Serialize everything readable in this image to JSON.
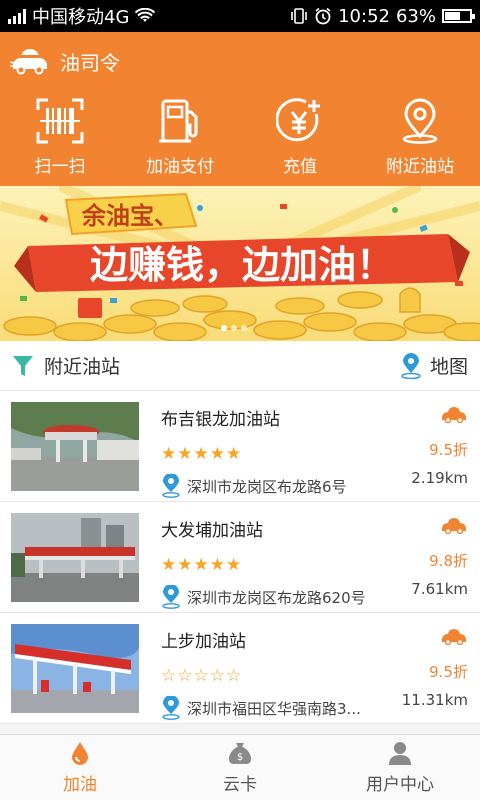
{
  "status_bar": {
    "carrier": "中国移动4G",
    "time": "10:52",
    "battery": "63%",
    "battery_level": 0.63,
    "icons": [
      "signal-icon",
      "wifi-icon",
      "vibrate-icon",
      "alarm-icon",
      "battery-icon"
    ]
  },
  "header": {
    "app_title": "油司令",
    "actions": [
      {
        "label": "扫一扫",
        "icon": "scan-icon"
      },
      {
        "label": "加油支付",
        "icon": "fuel-pump-icon"
      },
      {
        "label": "充值",
        "icon": "recharge-icon"
      },
      {
        "label": "附近油站",
        "icon": "location-pin-icon"
      }
    ]
  },
  "banner": {
    "tag": "余油宝、",
    "slogan": "边赚钱，边加油！",
    "page_count": 3,
    "active_page": 1
  },
  "section": {
    "title": "附近油站",
    "map_label": "地图",
    "icons": [
      "filter-icon",
      "map-pin-icon"
    ]
  },
  "stations": [
    {
      "name": "布吉银龙加油站",
      "rating": 5,
      "discount": "9.5折",
      "address": "深圳市龙岗区布龙路6号",
      "distance": "2.19km"
    },
    {
      "name": "大发埔加油站",
      "rating": 5,
      "discount": "9.8折",
      "address": "深圳市龙岗区布龙路620号",
      "distance": "7.61km"
    },
    {
      "name": "上步加油站",
      "rating": 0,
      "discount": "9.5折",
      "address": "深圳市福田区华强南路3...",
      "distance": "11.31km"
    }
  ],
  "tabbar": {
    "tabs": [
      {
        "label": "加油",
        "icon": "oil-drop-icon",
        "active": true
      },
      {
        "label": "云卡",
        "icon": "money-bag-icon",
        "active": false
      },
      {
        "label": "用户中心",
        "icon": "user-icon",
        "active": false
      }
    ]
  },
  "colors": {
    "brand_orange": "#f28431",
    "star": "#f5a623",
    "banner_bg": "#fbe8a0",
    "banner_red": "#e8462a"
  }
}
